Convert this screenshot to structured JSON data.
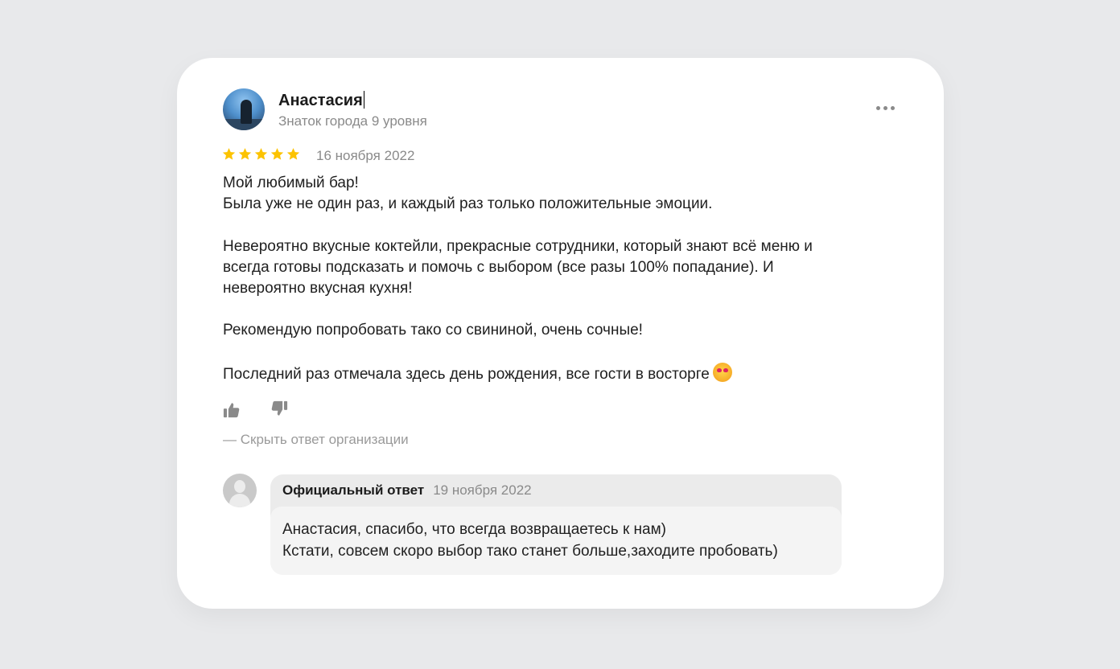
{
  "review": {
    "author_name": "Анастасия",
    "author_level": "Знаток города 9 уровня",
    "rating": 5,
    "date": "16 ноября 2022",
    "text": {
      "line1": "Мой любимый бар!",
      "line2": "Была уже не один раз, и каждый раз только положительные эмоции.",
      "line3": "Невероятно вкусные коктейли, прекрасные сотрудники, который знают всё меню и",
      "line4": "всегда готовы подсказать и помочь с выбором (все разы 100% попадание). И",
      "line5": "невероятно вкусная кухня!",
      "line6": "Рекомендую попробовать тако со свининой, очень сочные!",
      "line7": "Последний раз отмечала здесь день рождения, все гости в восторге"
    },
    "emoji": "smiling-face-with-hearts"
  },
  "actions": {
    "like_icon": "thumbs-up-icon",
    "dislike_icon": "thumbs-down-icon",
    "more_icon": "more-dots-icon",
    "hide_reply_label": "— Скрыть ответ организации"
  },
  "reply": {
    "title": "Официальный ответ",
    "date": "19 ноября 2022",
    "line1": "Анастасия, спасибо, что всегда возвращаетесь к нам)",
    "line2": "Кстати, совсем скоро выбор тако станет больше,заходите пробовать)"
  },
  "colors": {
    "background": "#e8e9eb",
    "card": "#ffffff",
    "star": "#fcc300",
    "muted_text": "#8a8a8a",
    "reply_header": "#ebebeb",
    "reply_body": "#f4f4f4"
  }
}
